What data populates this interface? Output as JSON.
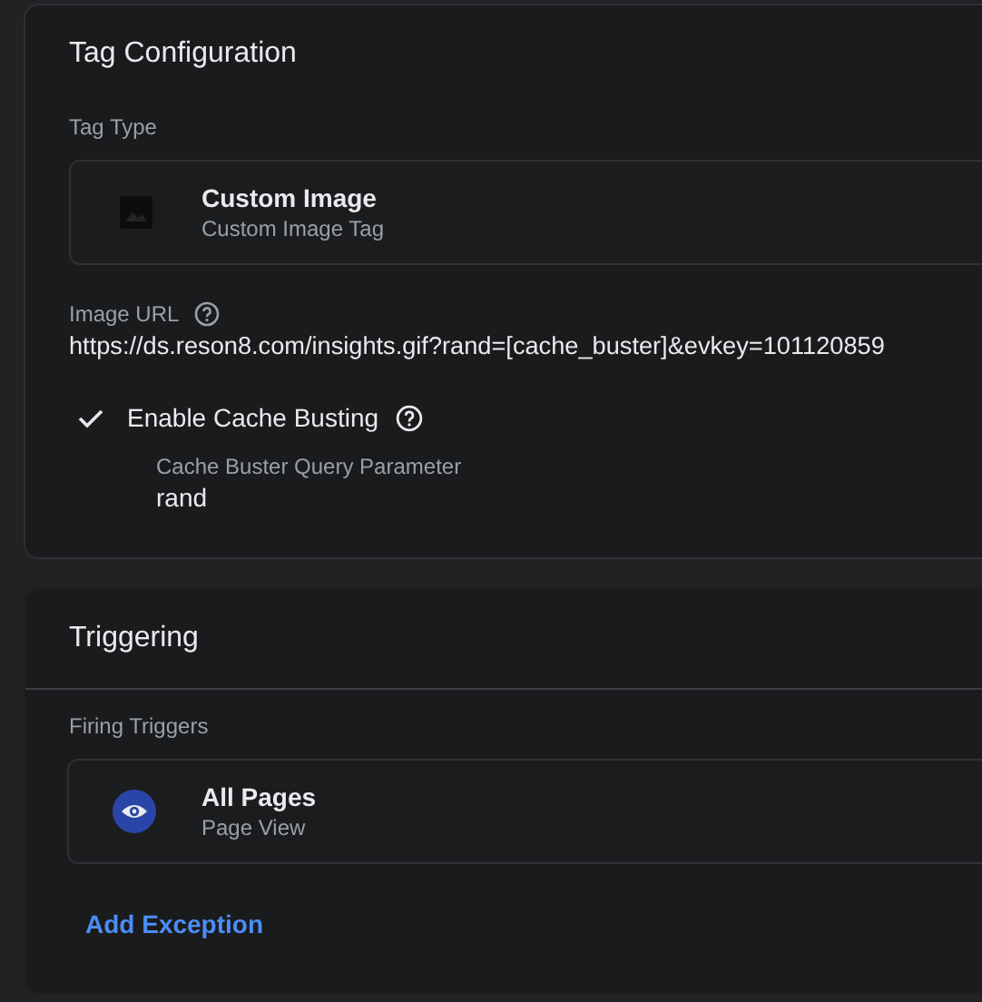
{
  "tag_configuration": {
    "title": "Tag Configuration",
    "tag_type": {
      "label": "Tag Type",
      "name": "Custom Image",
      "subtitle": "Custom Image Tag"
    },
    "image_url": {
      "label": "Image URL",
      "value": "https://ds.reson8.com/insights.gif?rand=[cache_buster]&evkey=101120859"
    },
    "cache_busting": {
      "label": "Enable Cache Busting",
      "checked": true,
      "parameter_label": "Cache Buster Query Parameter",
      "parameter_value": "rand"
    }
  },
  "triggering": {
    "title": "Triggering",
    "firing_triggers": {
      "label": "Firing Triggers",
      "items": [
        {
          "name": "All Pages",
          "type": "Page View"
        }
      ]
    },
    "add_exception": "Add Exception"
  }
}
